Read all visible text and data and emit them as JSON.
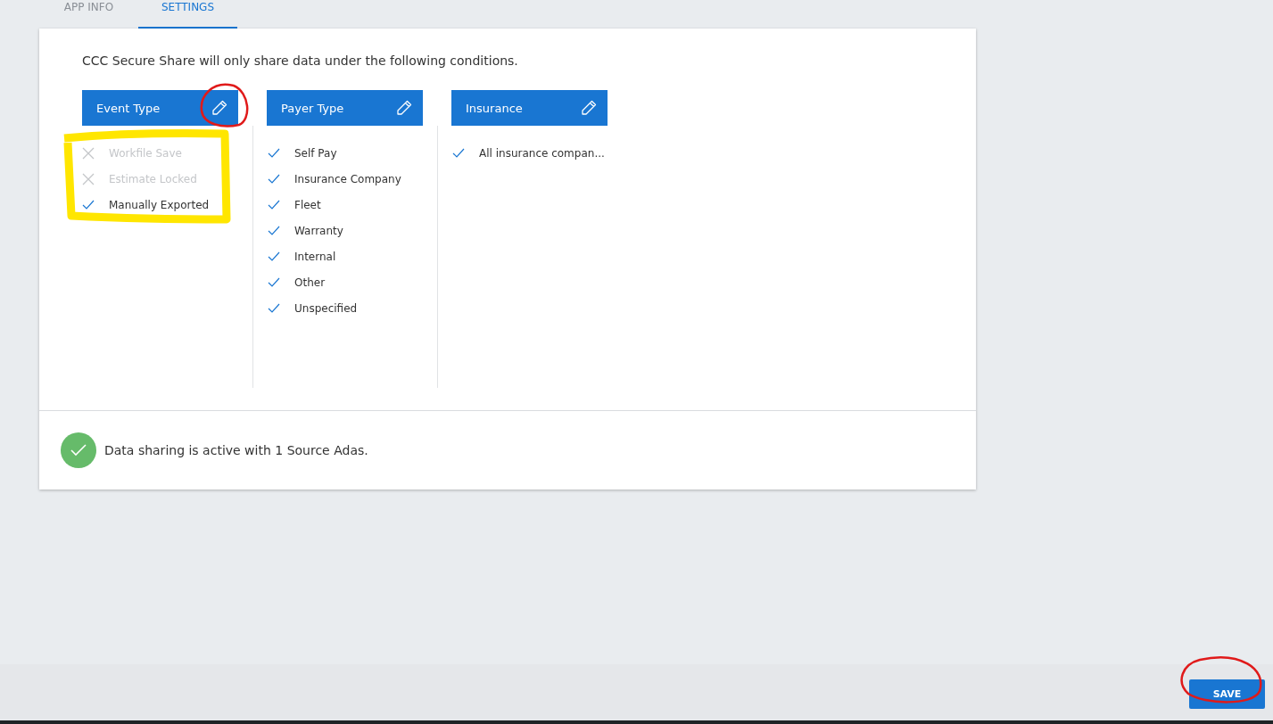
{
  "tabs": [
    {
      "label": "APP INFO",
      "selected": false
    },
    {
      "label": "SETTINGS",
      "selected": true
    }
  ],
  "intro": "CCC Secure Share will only share data under the following conditions.",
  "columns": [
    {
      "title": "Event Type",
      "items": [
        {
          "label": "Workfile Save",
          "checked": false
        },
        {
          "label": "Estimate Locked",
          "checked": false
        },
        {
          "label": "Manually Exported",
          "checked": true
        }
      ]
    },
    {
      "title": "Payer Type",
      "items": [
        {
          "label": "Self Pay",
          "checked": true
        },
        {
          "label": "Insurance Company",
          "checked": true
        },
        {
          "label": "Fleet",
          "checked": true
        },
        {
          "label": "Warranty",
          "checked": true
        },
        {
          "label": "Internal",
          "checked": true
        },
        {
          "label": "Other",
          "checked": true
        },
        {
          "label": "Unspecified",
          "checked": true
        }
      ]
    },
    {
      "title": "Insurance",
      "items": [
        {
          "label": "All insurance compan...",
          "checked": true
        }
      ]
    }
  ],
  "status": {
    "text": "Data sharing is active with 1 Source Adas.",
    "active": true
  },
  "save_button": "SAVE"
}
